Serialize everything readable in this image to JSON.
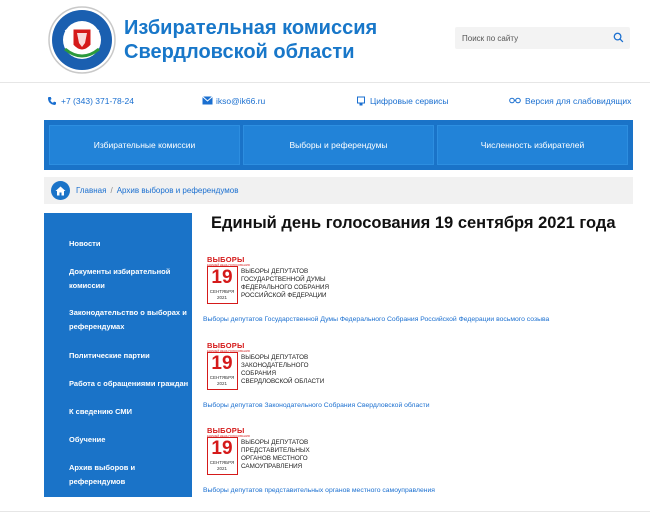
{
  "header": {
    "title_line1": "Избирательная комиссия",
    "title_line2": "Свердловской области",
    "logo_text": "ИЗБИРАТЕЛЬНАЯ КОМИССИЯ · СВЕРДЛОВСКАЯ ОБЛАСТЬ",
    "search_placeholder": "Поиск по сайту",
    "search_icon": "search-icon"
  },
  "contacts": {
    "phone": "+7 (343) 371-78-24",
    "email": "ikso@ik66.ru",
    "digital": "Цифровые сервисы",
    "accessibility": "Версия для слабовидящих"
  },
  "topnav": [
    {
      "label": "Избирательные комиссии"
    },
    {
      "label": "Выборы и референдумы"
    },
    {
      "label": "Численность избирателей"
    }
  ],
  "breadcrumb": {
    "home": "Главная",
    "separator": "/",
    "current": "Архив выборов и референдумов"
  },
  "sidebar": {
    "items": [
      {
        "label": "Новости"
      },
      {
        "label": "Документы избирательной комиссии"
      },
      {
        "label": "Законодательство о выборах и референдумах"
      },
      {
        "label": "Политические партии"
      },
      {
        "label": "Работа с обращениями граждан"
      },
      {
        "label": "К сведению СМИ"
      },
      {
        "label": "Обучение"
      },
      {
        "label": "Архив выборов и референдумов"
      }
    ]
  },
  "main": {
    "title": "Единый день голосования 19 сентября 2021 года",
    "banners": [
      {
        "brand": "ВЫБОРЫ",
        "brand_sub": "ЕДИНЫЙ ДЕНЬ ГОЛОСОВАНИЯ",
        "day": "19",
        "month": "СЕНТЯБРЯ",
        "year": "2021",
        "lines": [
          "ВЫБОРЫ ДЕПУТАТОВ",
          "ГОСУДАРСТВЕННОЙ ДУМЫ",
          "ФЕДЕРАЛЬНОГО СОБРАНИЯ",
          "РОССИЙСКОЙ ФЕДЕРАЦИИ"
        ],
        "link": "Выборы депутатов Государственной Думы Федерального Собрания Российской Федерации восьмого созыва"
      },
      {
        "brand": "ВЫБОРЫ",
        "brand_sub": "ЕДИНЫЙ ДЕНЬ ГОЛОСОВАНИЯ",
        "day": "19",
        "month": "СЕНТЯБРЯ",
        "year": "2021",
        "lines": [
          "ВЫБОРЫ ДЕПУТАТОВ",
          "ЗАКОНОДАТЕЛЬНОГО",
          "СОБРАНИЯ",
          "СВЕРДЛОВСКОЙ ОБЛАСТИ"
        ],
        "link": "Выборы депутатов Законодательного Собрания Свердловской области"
      },
      {
        "brand": "ВЫБОРЫ",
        "brand_sub": "ЕДИНЫЙ ДЕНЬ ГОЛОСОВАНИЯ",
        "day": "19",
        "month": "СЕНТЯБРЯ",
        "year": "2021",
        "lines": [
          "ВЫБОРЫ ДЕПУТАТОВ",
          "ПРЕДСТАВИТЕЛЬНЫХ",
          "ОРГАНОВ МЕСТНОГО",
          "САМОУПРАВЛЕНИЯ"
        ],
        "link": "Выборы депутатов представительных органов местного самоуправления"
      }
    ]
  },
  "colors": {
    "brand_blue": "#1a73c8",
    "link_blue": "#1a6fd0",
    "title_blue": "#1877c9",
    "vybory_red": "#d51a1a"
  }
}
